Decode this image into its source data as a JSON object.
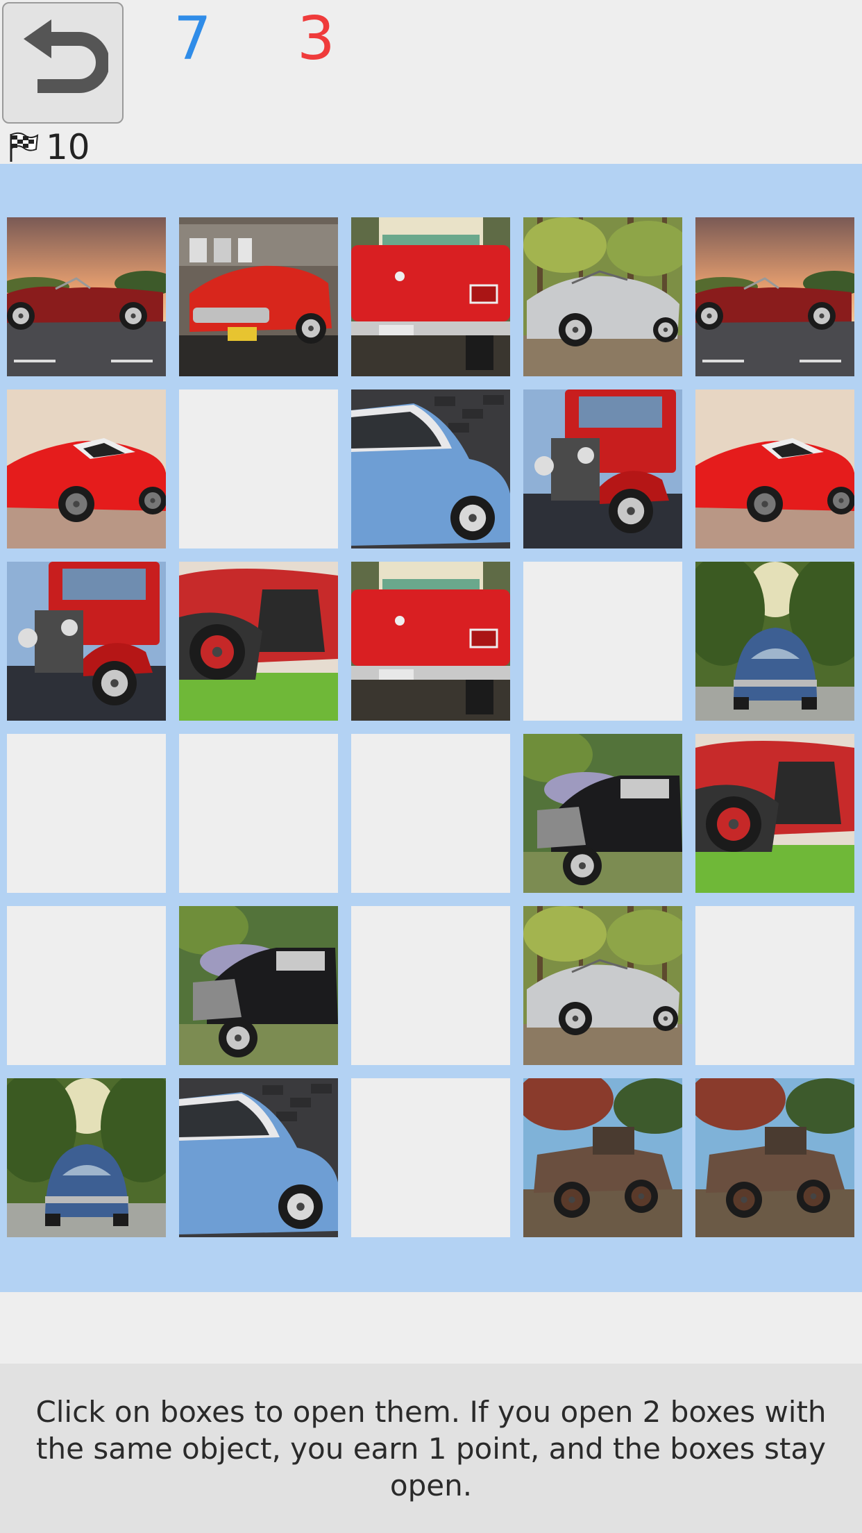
{
  "header": {
    "undo_icon": "undo-arrow-icon",
    "score_player1": "7",
    "score_player2": "3",
    "moves_icon": "checkered-flag-icon",
    "moves_count": "10"
  },
  "board": {
    "rows": 6,
    "cols": 5,
    "tiles": [
      "red-roadster-sunset",
      "red-thunderbird",
      "red-mustang-rear",
      "silver-porsche",
      "red-roadster-sunset",
      "red-ferrari",
      "empty",
      "blue-smart-car",
      "red-hot-rod",
      "red-ferrari",
      "red-hot-rod",
      "red-old-truck",
      "red-mustang-rear",
      "empty",
      "blue-beetle",
      "empty",
      "empty",
      "empty",
      "black-hot-rod",
      "red-old-truck",
      "empty",
      "black-hot-rod",
      "empty",
      "silver-porsche",
      "empty",
      "blue-beetle",
      "blue-smart-car",
      "empty",
      "rusty-antique-car",
      "rusty-antique-car"
    ]
  },
  "footer": {
    "instructions": "Click on boxes to open them. If you open 2 boxes with the same object, you earn 1 point, and the boxes stay open."
  },
  "colors": {
    "board_bg": "#b3d2f3",
    "empty_tile": "#eeeeee",
    "score_blue": "#2f8ce8",
    "score_red": "#ef3b3b"
  }
}
